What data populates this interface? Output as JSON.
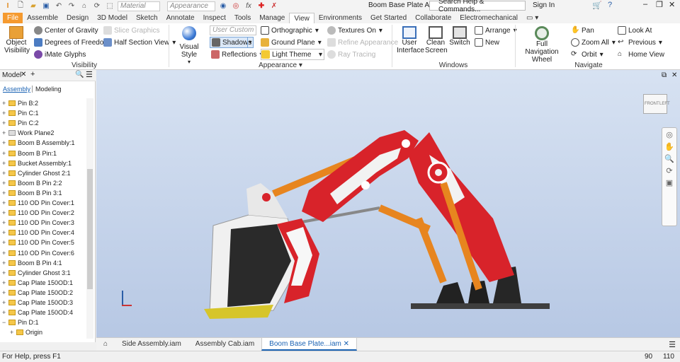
{
  "titlebar": {
    "material": "Material",
    "appearance": "Appearance",
    "doc_title": "Boom Base Plate Assembly",
    "search": "Search Help & Commands...",
    "sign_in": "Sign In",
    "help": "?"
  },
  "tabs": [
    "File",
    "Assemble",
    "Design",
    "3D Model",
    "Sketch",
    "Annotate",
    "Inspect",
    "Tools",
    "Manage",
    "View",
    "Environments",
    "Get Started",
    "Collaborate",
    "Electromechanical"
  ],
  "ribbon": {
    "visibility": {
      "object_visibility": "Object Visibility",
      "center_of_gravity": "Center of Gravity",
      "degrees_of_freedom": "Degrees of Freedom",
      "imate_glyphs": "iMate Glyphs",
      "slice_graphics": "Slice Graphics",
      "half_section_view": "Half Section View",
      "title": "Visibility"
    },
    "appearance": {
      "visual_style": "Visual Style",
      "user_custom": "User Custom",
      "shadows": "Shadows",
      "reflections": "Reflections",
      "orthographic": "Orthographic",
      "ground_plane": "Ground Plane",
      "light_theme": "Light Theme",
      "textures_on": "Textures On",
      "refine_appearance": "Refine Appearance",
      "ray_tracing": "Ray Tracing",
      "title": "Appearance"
    },
    "windows": {
      "user_interface": "User Interface",
      "clean_screen": "Clean Screen",
      "switch": "Switch",
      "arrange": "Arrange",
      "new": "New",
      "title": "Windows"
    },
    "navigate": {
      "full_nav_wheel": "Full Navigation Wheel",
      "pan": "Pan",
      "zoom_all": "Zoom All",
      "orbit": "Orbit",
      "look_at": "Look At",
      "previous": "Previous",
      "home_view": "Home View",
      "title": "Navigate"
    }
  },
  "browser": {
    "title": "Model",
    "tab_assembly": "Assembly",
    "tab_modeling": "Modeling",
    "items": [
      "Pin B:2",
      "Pin C:1",
      "Pin C:2",
      "Work Plane2",
      "Boom B Assembly:1",
      "Boom  B Pin:1",
      "Bucket Assembly:1",
      "Cylinder Ghost 2:1",
      "Boom  B Pin 2:2",
      "Boom  B Pin 3:1",
      "110 OD Pin Cover:1",
      "110 OD Pin Cover:2",
      "110 OD Pin Cover:3",
      "110 OD Pin Cover:4",
      "110 OD Pin Cover:5",
      "110 OD Pin Cover:6",
      "Boom  B Pin 4:1",
      "Cylinder Ghost 3:1",
      "Cap Plate 150OD:1",
      "Cap Plate 150OD:2",
      "Cap Plate 150OD:3",
      "Cap Plate 150OD:4",
      "Pin D:1",
      "Origin"
    ]
  },
  "viewcube": {
    "front": "FRONT",
    "left": "LEFT"
  },
  "doc_tabs": [
    "Side Assembly.iam",
    "Assembly Cab.iam",
    "Boom Base Plate...iam"
  ],
  "status": {
    "help": "For Help, press F1",
    "count1": "90",
    "count2": "110"
  },
  "colors": {
    "accent": "#f59a2f",
    "active_tab": "#1a62b3",
    "model_red": "#d8232a"
  }
}
